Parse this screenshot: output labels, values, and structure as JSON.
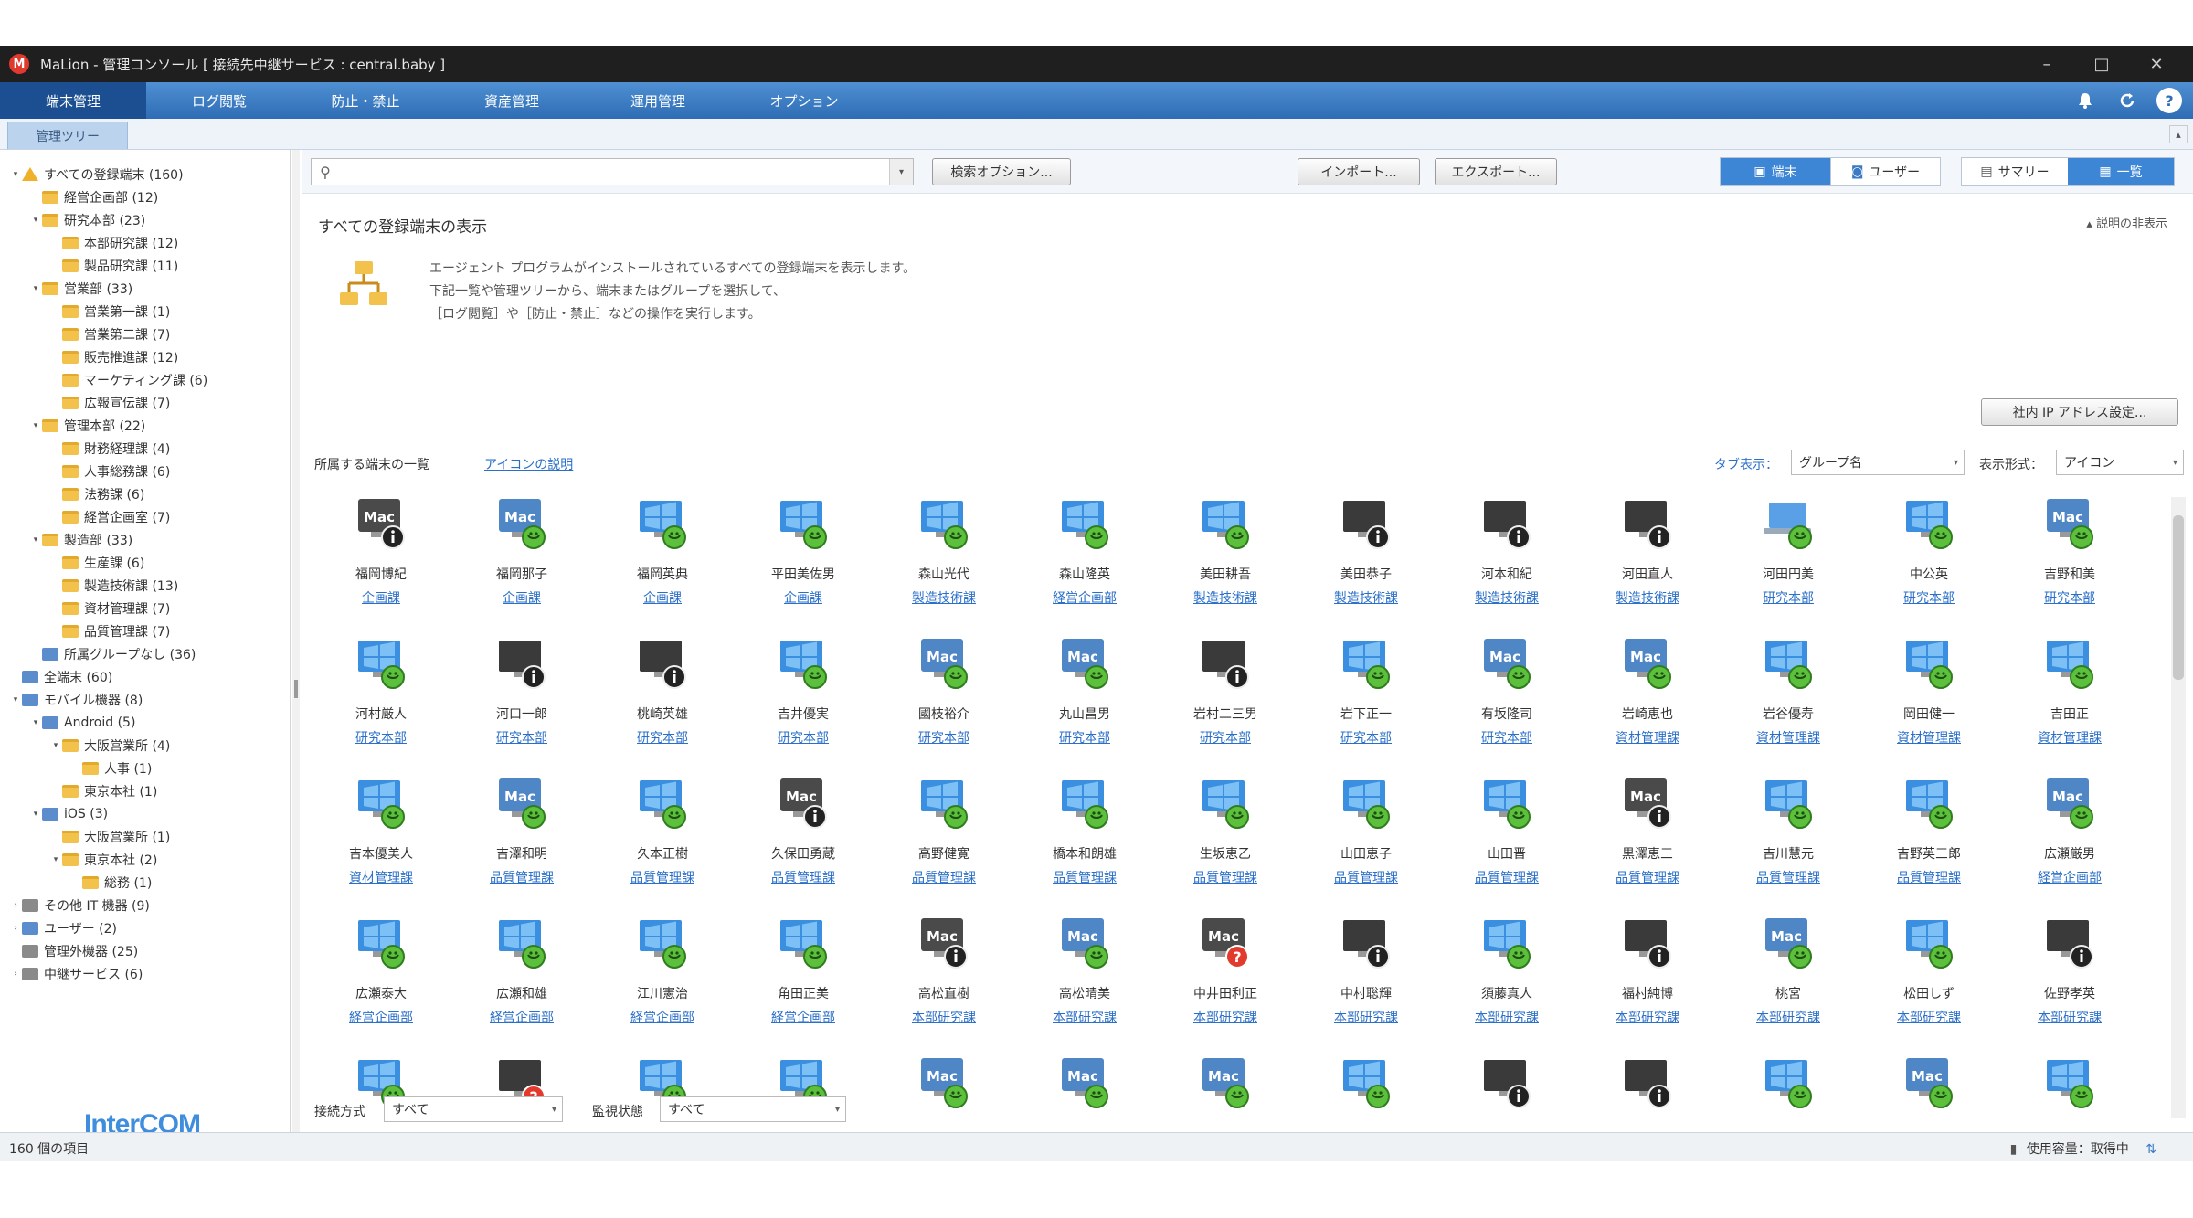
{
  "window": {
    "title": "MaLion - 管理コンソール [ 接続先中継サービス : central.baby ]",
    "logo": "M"
  },
  "window_controls": {
    "minimize": "–",
    "maximize": "□",
    "close": "✕"
  },
  "menu": [
    "端末管理",
    "ログ閲覧",
    "防止・禁止",
    "資産管理",
    "運用管理",
    "オプション"
  ],
  "menu_icons": [
    "bell-icon",
    "refresh-icon",
    "help-icon"
  ],
  "tab": "管理ツリー",
  "tree": [
    {
      "label": "すべての登録端末 (160)",
      "depth": 0,
      "icon": "warn",
      "arrow": "▾"
    },
    {
      "label": "経営企画部 (12)",
      "depth": 1,
      "icon": "folder",
      "arrow": ""
    },
    {
      "label": "研究本部 (23)",
      "depth": 1,
      "icon": "folder",
      "arrow": "▾"
    },
    {
      "label": "本部研究課 (12)",
      "depth": 2,
      "icon": "folder",
      "arrow": ""
    },
    {
      "label": "製品研究課 (11)",
      "depth": 2,
      "icon": "folder",
      "arrow": ""
    },
    {
      "label": "営業部 (33)",
      "depth": 1,
      "icon": "folder",
      "arrow": "▾"
    },
    {
      "label": "営業第一課 (1)",
      "depth": 2,
      "icon": "folder",
      "arrow": ""
    },
    {
      "label": "営業第二課 (7)",
      "depth": 2,
      "icon": "folder",
      "arrow": ""
    },
    {
      "label": "販売推進課 (12)",
      "depth": 2,
      "icon": "folder",
      "arrow": ""
    },
    {
      "label": "マーケティング課 (6)",
      "depth": 2,
      "icon": "folder",
      "arrow": ""
    },
    {
      "label": "広報宣伝課 (7)",
      "depth": 2,
      "icon": "folder",
      "arrow": ""
    },
    {
      "label": "管理本部 (22)",
      "depth": 1,
      "icon": "folder",
      "arrow": "▾"
    },
    {
      "label": "財務経理課 (4)",
      "depth": 2,
      "icon": "folder",
      "arrow": ""
    },
    {
      "label": "人事総務課 (6)",
      "depth": 2,
      "icon": "folder",
      "arrow": ""
    },
    {
      "label": "法務課 (6)",
      "depth": 2,
      "icon": "folder",
      "arrow": ""
    },
    {
      "label": "経営企画室 (7)",
      "depth": 2,
      "icon": "folder",
      "arrow": ""
    },
    {
      "label": "製造部 (33)",
      "depth": 1,
      "icon": "folder",
      "arrow": "▾"
    },
    {
      "label": "生産課 (6)",
      "depth": 2,
      "icon": "folder",
      "arrow": ""
    },
    {
      "label": "製造技術課 (13)",
      "depth": 2,
      "icon": "folder",
      "arrow": ""
    },
    {
      "label": "資材管理課 (7)",
      "depth": 2,
      "icon": "folder",
      "arrow": ""
    },
    {
      "label": "品質管理課 (7)",
      "depth": 2,
      "icon": "folder",
      "arrow": ""
    },
    {
      "label": "所属グループなし (36)",
      "depth": 1,
      "icon": "device",
      "arrow": ""
    },
    {
      "label": "全端末 (60)",
      "depth": 0,
      "icon": "device",
      "arrow": ""
    },
    {
      "label": "モバイル機器 (8)",
      "depth": 0,
      "icon": "device",
      "arrow": "▾"
    },
    {
      "label": "Android (5)",
      "depth": 1,
      "icon": "device",
      "arrow": "▾"
    },
    {
      "label": "大阪営業所 (4)",
      "depth": 2,
      "icon": "folder",
      "arrow": "▾"
    },
    {
      "label": "人事 (1)",
      "depth": 3,
      "icon": "folder",
      "arrow": ""
    },
    {
      "label": "東京本社 (1)",
      "depth": 2,
      "icon": "folder",
      "arrow": ""
    },
    {
      "label": "iOS (3)",
      "depth": 1,
      "icon": "device",
      "arrow": "▾"
    },
    {
      "label": "大阪営業所 (1)",
      "depth": 2,
      "icon": "folder",
      "arrow": ""
    },
    {
      "label": "東京本社 (2)",
      "depth": 2,
      "icon": "folder",
      "arrow": "▾"
    },
    {
      "label": "総務 (1)",
      "depth": 3,
      "icon": "folder",
      "arrow": ""
    },
    {
      "label": "その他 IT 機器 (9)",
      "depth": 0,
      "icon": "grey",
      "arrow": "›"
    },
    {
      "label": "ユーザー (2)",
      "depth": 0,
      "icon": "device",
      "arrow": "›"
    },
    {
      "label": "管理外機器 (25)",
      "depth": 0,
      "icon": "grey",
      "arrow": ""
    },
    {
      "label": "中継サービス (6)",
      "depth": 0,
      "icon": "grey",
      "arrow": "›"
    }
  ],
  "brand": "InterCOM",
  "toolbar": {
    "search_placeholder": "",
    "search_option": "検索オプション...",
    "import": "インポート...",
    "export": "エクスポート...",
    "view_terminal": "端末",
    "view_user": "ユーザー",
    "view_summary": "サマリー",
    "view_list": "一覧"
  },
  "main": {
    "heading": "すべての登録端末の表示",
    "hide_desc": "▴ 説明の非表示",
    "desc_lines": [
      "エージェント プログラムがインストールされているすべての登録端末を表示します。",
      "下記一覧や管理ツリーから、端末またはグループを選択して、",
      "［ログ閲覧］や［防止・禁止］などの操作を実行します。"
    ],
    "ip_button": "社内 IP アドレス設定...",
    "list_label": "所属する端末の一覧",
    "icon_link": "アイコンの説明",
    "tab_label": "タブ表示：",
    "tab_value": "グループ名",
    "display_label": "表示形式：",
    "display_value": "アイコン"
  },
  "terminals": [
    {
      "name": "福岡博紀",
      "group": "企画課",
      "icon": "mac-locked"
    },
    {
      "name": "福岡那子",
      "group": "企画課",
      "icon": "mac-ok"
    },
    {
      "name": "福岡英典",
      "group": "企画課",
      "icon": "win-ok"
    },
    {
      "name": "平田美佐男",
      "group": "企画課",
      "icon": "win-ok"
    },
    {
      "name": "森山光代",
      "group": "製造技術課",
      "icon": "win-ok"
    },
    {
      "name": "森山隆英",
      "group": "経営企画部",
      "icon": "win-ok"
    },
    {
      "name": "美田耕吾",
      "group": "製造技術課",
      "icon": "win-ok"
    },
    {
      "name": "美田恭子",
      "group": "製造技術課",
      "icon": "win-locked"
    },
    {
      "name": "河本和紀",
      "group": "製造技術課",
      "icon": "win-locked"
    },
    {
      "name": "河田直人",
      "group": "製造技術課",
      "icon": "win-locked"
    },
    {
      "name": "河田円美",
      "group": "研究本部",
      "icon": "laptop-ok"
    },
    {
      "name": "中公英",
      "group": "研究本部",
      "icon": "win-ok"
    },
    {
      "name": "吉野和美",
      "group": "研究本部",
      "icon": "mac-ok"
    },
    {
      "name": "河村厳人",
      "group": "研究本部",
      "icon": "win-ok"
    },
    {
      "name": "河口一郎",
      "group": "研究本部",
      "icon": "win-locked"
    },
    {
      "name": "桃崎英雄",
      "group": "研究本部",
      "icon": "win-locked"
    },
    {
      "name": "吉井優実",
      "group": "研究本部",
      "icon": "win-ok"
    },
    {
      "name": "國枝裕介",
      "group": "研究本部",
      "icon": "mac-ok"
    },
    {
      "name": "丸山昌男",
      "group": "研究本部",
      "icon": "mac-ok"
    },
    {
      "name": "岩村二三男",
      "group": "研究本部",
      "icon": "win-locked"
    },
    {
      "name": "岩下正一",
      "group": "研究本部",
      "icon": "win-ok"
    },
    {
      "name": "有坂隆司",
      "group": "研究本部",
      "icon": "mac-ok"
    },
    {
      "name": "岩崎恵也",
      "group": "資材管理課",
      "icon": "mac-ok"
    },
    {
      "name": "岩谷優寿",
      "group": "資材管理課",
      "icon": "win-ok"
    },
    {
      "name": "岡田健一",
      "group": "資材管理課",
      "icon": "win-ok"
    },
    {
      "name": "吉田正",
      "group": "資材管理課",
      "icon": "win-ok"
    },
    {
      "name": "吉本優美人",
      "group": "資材管理課",
      "icon": "win-ok"
    },
    {
      "name": "吉澤和明",
      "group": "品質管理課",
      "icon": "mac-ok"
    },
    {
      "name": "久本正樹",
      "group": "品質管理課",
      "icon": "win-ok"
    },
    {
      "name": "久保田勇蔵",
      "group": "品質管理課",
      "icon": "mac-locked"
    },
    {
      "name": "高野健寛",
      "group": "品質管理課",
      "icon": "win-ok"
    },
    {
      "name": "橋本和朗雄",
      "group": "品質管理課",
      "icon": "win-ok"
    },
    {
      "name": "生坂恵乙",
      "group": "品質管理課",
      "icon": "win-ok"
    },
    {
      "name": "山田恵子",
      "group": "品質管理課",
      "icon": "win-ok"
    },
    {
      "name": "山田晋",
      "group": "品質管理課",
      "icon": "win-ok"
    },
    {
      "name": "黒澤恵三",
      "group": "品質管理課",
      "icon": "mac-locked"
    },
    {
      "name": "吉川慧元",
      "group": "品質管理課",
      "icon": "win-ok"
    },
    {
      "name": "吉野英三郎",
      "group": "品質管理課",
      "icon": "win-ok"
    },
    {
      "name": "広瀬厳男",
      "group": "経営企画部",
      "icon": "mac-ok"
    },
    {
      "name": "広瀬泰大",
      "group": "経営企画部",
      "icon": "win-ok"
    },
    {
      "name": "広瀬和雄",
      "group": "経営企画部",
      "icon": "win-ok"
    },
    {
      "name": "江川憲治",
      "group": "経営企画部",
      "icon": "win-ok"
    },
    {
      "name": "角田正美",
      "group": "経営企画部",
      "icon": "win-ok"
    },
    {
      "name": "高松直樹",
      "group": "本部研究課",
      "icon": "mac-locked"
    },
    {
      "name": "高松晴美",
      "group": "本部研究課",
      "icon": "mac-ok"
    },
    {
      "name": "中井田利正",
      "group": "本部研究課",
      "icon": "mac-question"
    },
    {
      "name": "中村聡輝",
      "group": "本部研究課",
      "icon": "win-locked"
    },
    {
      "name": "須藤真人",
      "group": "本部研究課",
      "icon": "win-ok"
    },
    {
      "name": "福村純博",
      "group": "本部研究課",
      "icon": "win-locked"
    },
    {
      "name": "桃宮",
      "group": "本部研究課",
      "icon": "mac-ok"
    },
    {
      "name": "松田しず",
      "group": "本部研究課",
      "icon": "win-ok"
    },
    {
      "name": "佐野孝英",
      "group": "本部研究課",
      "icon": "win-locked"
    },
    {
      "name": "",
      "group": "",
      "icon": "win-ok"
    },
    {
      "name": "",
      "group": "",
      "icon": "win-question"
    },
    {
      "name": "",
      "group": "",
      "icon": "win-ok"
    },
    {
      "name": "",
      "group": "",
      "icon": "win-ok"
    },
    {
      "name": "",
      "group": "",
      "icon": "mac-ok"
    },
    {
      "name": "",
      "group": "",
      "icon": "mac-ok"
    },
    {
      "name": "",
      "group": "",
      "icon": "mac-ok"
    },
    {
      "name": "",
      "group": "",
      "icon": "win-ok"
    },
    {
      "name": "",
      "group": "",
      "icon": "win-locked"
    },
    {
      "name": "",
      "group": "",
      "icon": "win-locked"
    },
    {
      "name": "",
      "group": "",
      "icon": "win-ok"
    },
    {
      "name": "",
      "group": "",
      "icon": "mac-ok"
    },
    {
      "name": "",
      "group": "",
      "icon": "win-ok"
    }
  ],
  "filters": {
    "connect_label": "接続方式",
    "connect_value": "すべて",
    "status_label": "監視状態",
    "status_value": "すべて"
  },
  "status": {
    "count": "160 個の項目",
    "license": "使用容量：取得中"
  },
  "colors": {
    "accent": "#2e6db5",
    "link": "#2a6fc9",
    "ok": "#5cc03c",
    "alert": "#e23b2e"
  }
}
